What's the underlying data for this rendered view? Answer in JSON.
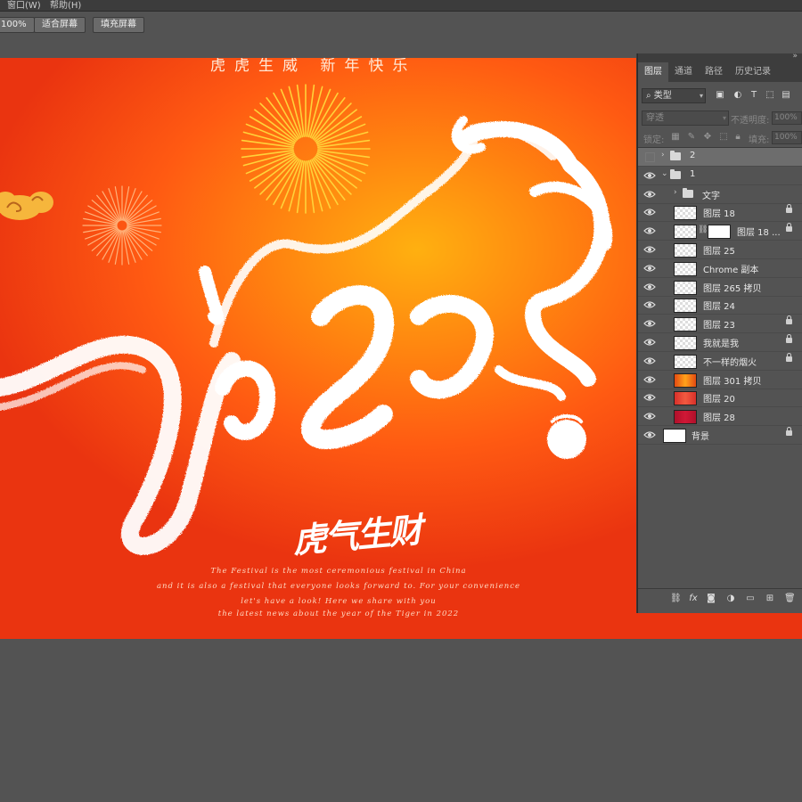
{
  "menu": {
    "window": "窗口(W)",
    "help": "帮助(H)"
  },
  "options": {
    "zoom": "100%",
    "fit_screen": "适合屏幕",
    "fill_screen": "填充屏幕"
  },
  "poster": {
    "top_slogan": "虎虎生威  新年快乐",
    "headline": "虎气生财",
    "english_lines": [
      "The Festival is the most ceremonious festival in China",
      "and it is also a festival that everyone looks forward to. For your convenience",
      "let's have a look! Here we share with you",
      "the latest news about the year of the Tiger in 2022"
    ],
    "colors": {
      "bg_center": "#ffb010",
      "bg_edge": "#ea3410",
      "firework_yellow": "#ffd23a",
      "cloud": "#f6b63c"
    }
  },
  "layers_panel": {
    "collapse_glyph": "»",
    "tabs": [
      "图层",
      "通道",
      "路径",
      "历史记录"
    ],
    "active_tab": "图层",
    "filter_kind": "类型",
    "filter_icons": [
      "image-filter-icon",
      "adjustment-filter-icon",
      "type-filter-icon",
      "shape-filter-icon",
      "smart-object-filter-icon"
    ],
    "blend_mode": "穿透",
    "opacity_label": "不透明度:",
    "opacity_value": "100%",
    "lock_label": "锁定:",
    "fill_label": "填充:",
    "fill_value": "100%",
    "layers": [
      {
        "name": "2",
        "kind": "group",
        "visible": false,
        "expanded": false,
        "selected": true,
        "locked": false
      },
      {
        "name": "1",
        "kind": "group",
        "visible": true,
        "expanded": true,
        "selected": false,
        "locked": false
      },
      {
        "name": "文字",
        "kind": "group",
        "visible": true,
        "expanded": false,
        "selected": false,
        "locked": false
      },
      {
        "name": "图层 18",
        "kind": "layer",
        "visible": true,
        "thumb": "checker",
        "locked": true
      },
      {
        "name": "图层 18 ...",
        "kind": "masked",
        "visible": true,
        "thumb": "checker",
        "locked": true
      },
      {
        "name": "图层 25",
        "kind": "layer",
        "visible": true,
        "thumb": "checker",
        "locked": false
      },
      {
        "name": "Chrome 副本",
        "kind": "layer",
        "visible": true,
        "thumb": "checker",
        "locked": false
      },
      {
        "name": "图层 265 拷贝",
        "kind": "layer",
        "visible": true,
        "thumb": "checker",
        "locked": false
      },
      {
        "name": "图层 24",
        "kind": "layer",
        "visible": true,
        "thumb": "checker",
        "locked": false
      },
      {
        "name": "图层 23",
        "kind": "layer",
        "visible": true,
        "thumb": "checker",
        "locked": true
      },
      {
        "name": "我就是我",
        "kind": "layer",
        "visible": true,
        "thumb": "checker",
        "locked": true
      },
      {
        "name": "不一样的烟火",
        "kind": "layer",
        "visible": true,
        "thumb": "checker",
        "locked": true
      },
      {
        "name": "图层 301 拷贝",
        "kind": "layer",
        "visible": true,
        "thumb": "orange",
        "locked": false
      },
      {
        "name": "图层 20",
        "kind": "layer",
        "visible": true,
        "thumb": "red",
        "locked": false
      },
      {
        "name": "图层 28",
        "kind": "layer",
        "visible": true,
        "thumb": "crimson",
        "locked": false
      },
      {
        "name": "背景",
        "kind": "background",
        "visible": true,
        "thumb": "white",
        "locked": true
      }
    ],
    "bottom_icons": [
      "link-layers-icon",
      "fx-icon",
      "add-mask-icon",
      "adjustment-layer-icon",
      "new-group-icon",
      "new-layer-icon",
      "delete-layer-icon"
    ],
    "fx_label": "fx"
  }
}
